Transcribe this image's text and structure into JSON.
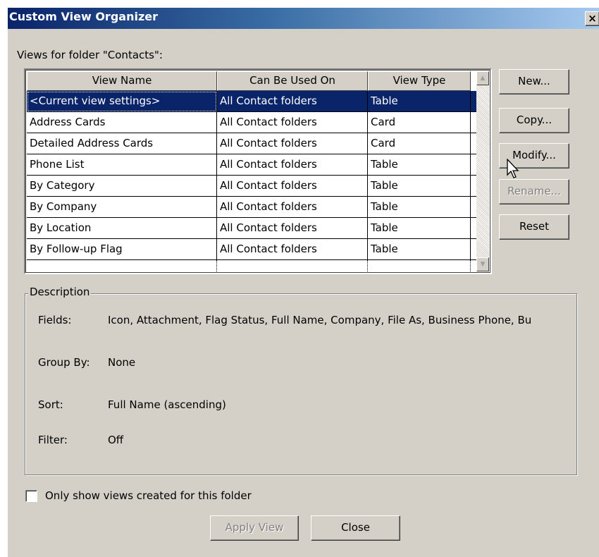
{
  "window": {
    "title": "Custom View Organizer",
    "close_glyph": "×"
  },
  "views_label": "Views for folder \"Contacts\":",
  "list": {
    "columns": [
      "View Name",
      "Can Be Used On",
      "View Type"
    ],
    "rows": [
      {
        "name": "<Current view settings>",
        "used_on": "All Contact folders",
        "type": "Table",
        "selected": true
      },
      {
        "name": "Address Cards",
        "used_on": "All Contact folders",
        "type": "Card"
      },
      {
        "name": "Detailed Address Cards",
        "used_on": "All Contact folders",
        "type": "Card"
      },
      {
        "name": "Phone List",
        "used_on": "All Contact folders",
        "type": "Table"
      },
      {
        "name": "By Category",
        "used_on": "All Contact folders",
        "type": "Table"
      },
      {
        "name": "By Company",
        "used_on": "All Contact folders",
        "type": "Table"
      },
      {
        "name": "By Location",
        "used_on": "All Contact folders",
        "type": "Table"
      },
      {
        "name": "By Follow-up Flag",
        "used_on": "All Contact folders",
        "type": "Table"
      }
    ]
  },
  "side_buttons": {
    "new": "New...",
    "copy": "Copy...",
    "modify": "Modify...",
    "rename": "Rename...",
    "reset": "Reset"
  },
  "description": {
    "legend": "Description",
    "fields_label": "Fields:",
    "fields_value": "Icon, Attachment, Flag Status, Full Name, Company, File As, Business Phone, Bu",
    "groupby_label": "Group By:",
    "groupby_value": "None",
    "sort_label": "Sort:",
    "sort_value": "Full Name (ascending)",
    "filter_label": "Filter:",
    "filter_value": "Off"
  },
  "only_show_checkbox": {
    "label": "Only show views created for this folder",
    "checked": false
  },
  "bottom_buttons": {
    "apply": "Apply View",
    "close": "Close"
  },
  "colors": {
    "dialog_face": "#d4d0c8",
    "title_start": "#0a246a",
    "title_end": "#a6caf0",
    "selection": "#0a246a"
  }
}
